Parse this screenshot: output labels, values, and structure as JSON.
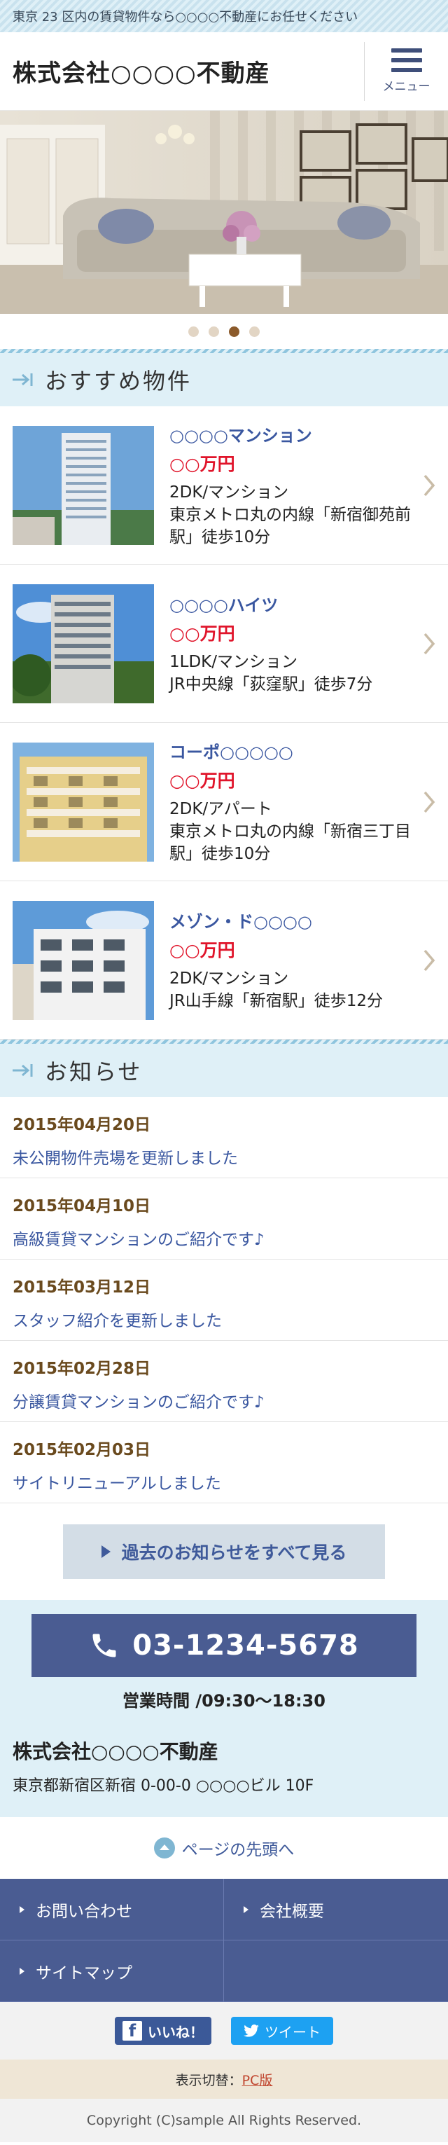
{
  "tagline": "東京 23 区内の賃貸物件なら○○○○不動産にお任せください",
  "header": {
    "site_title": "株式会社○○○○不動産",
    "menu_label": "メニュー"
  },
  "hero": {
    "slides": 4,
    "active_slide": 3
  },
  "recommended": {
    "heading": "おすすめ物件",
    "items": [
      {
        "name": "○○○○マンション",
        "price": "○○万円",
        "type": "2DK/マンション",
        "access": "東京メトロ丸の内線「新宿御苑前駅」徒歩10分"
      },
      {
        "name": "○○○○ハイツ",
        "price": "○○万円",
        "type": "1LDK/マンション",
        "access": "JR中央線「荻窪駅」徒歩7分"
      },
      {
        "name": "コーポ○○○○○",
        "price": "○○万円",
        "type": "2DK/アパート",
        "access": "東京メトロ丸の内線「新宿三丁目駅」徒歩10分"
      },
      {
        "name": "メゾン・ド○○○○",
        "price": "○○万円",
        "type": "2DK/マンション",
        "access": "JR山手線「新宿駅」徒歩12分"
      }
    ]
  },
  "news": {
    "heading": "お知らせ",
    "items": [
      {
        "date": "2015年04月20日",
        "text": "未公開物件売場を更新しました"
      },
      {
        "date": "2015年04月10日",
        "text": "高級賃貸マンションのご紹介です♪"
      },
      {
        "date": "2015年03月12日",
        "text": "スタッフ紹介を更新しました"
      },
      {
        "date": "2015年02月28日",
        "text": "分譲賃貸マンションのご紹介です♪"
      },
      {
        "date": "2015年02月03日",
        "text": "サイトリニューアルしました"
      }
    ],
    "more_label": "過去のお知らせをすべて見る"
  },
  "contact": {
    "tel": "03-1234-5678",
    "hours": "営業時間 /09:30～18:30",
    "company": "株式会社○○○○不動産",
    "address": "東京都新宿区新宿 0-00-0 ○○○○ビル 10F"
  },
  "pagetop_label": "ページの先頭へ",
  "footer_nav": {
    "inquiry": "お問い合わせ",
    "about": "会社概要",
    "sitemap": "サイトマップ"
  },
  "social": {
    "like_label": "いいね！",
    "tweet_label": "ツイート"
  },
  "switch": {
    "prefix": "表示切替：",
    "link": "PC版"
  },
  "copyright": "Copyright (C)sample All Rights Reserved.",
  "colors": {
    "brand_blue": "#4a5c92",
    "light_blue": "#dff0f7",
    "price_red": "#e0142a",
    "date_brown": "#6a4a1e"
  }
}
